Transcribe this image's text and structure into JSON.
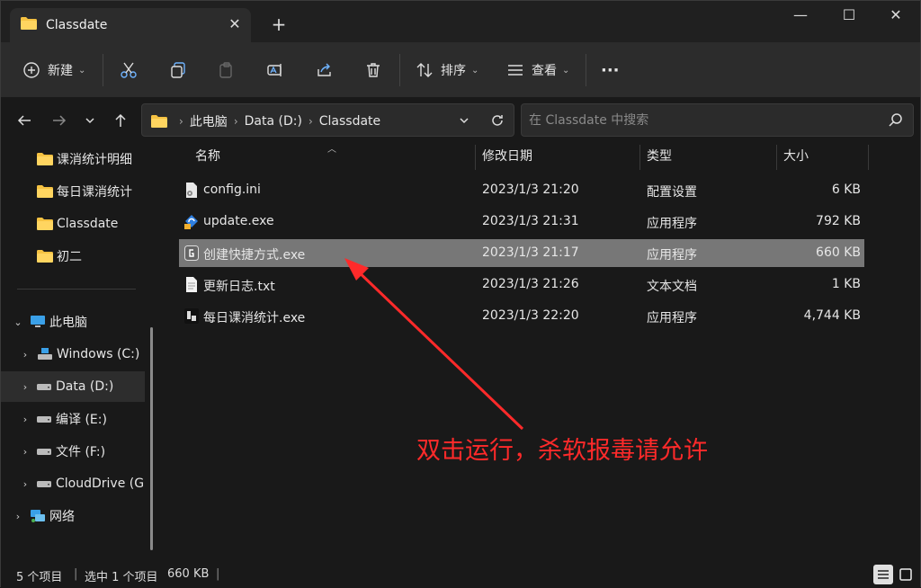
{
  "window": {
    "tab_title": "Classdate",
    "tab_close": "✕",
    "new_tab": "+",
    "minimize": "—",
    "maximize": "☐",
    "close": "✕"
  },
  "toolbar": {
    "new_label": "新建",
    "sort_label": "排序",
    "view_label": "查看",
    "more_label": "···"
  },
  "address": {
    "crumbs": [
      "此电脑",
      "Data (D:)",
      "Classdate"
    ],
    "search_placeholder": "在 Classdate 中搜索"
  },
  "sidebar": {
    "quick": [
      "课消统计明细",
      "每日课消统计",
      "Classdate",
      "初二"
    ],
    "this_pc": "此电脑",
    "drives": [
      "Windows (C:)",
      "Data (D:)",
      "编译 (E:)",
      "文件 (F:)",
      "CloudDrive (G"
    ],
    "network": "网络"
  },
  "columns": {
    "name": "名称",
    "date": "修改日期",
    "type": "类型",
    "size": "大小"
  },
  "files": [
    {
      "name": "config.ini",
      "date": "2023/1/3 21:20",
      "type": "配置设置",
      "size": "6 KB",
      "icon": "ini-file-icon"
    },
    {
      "name": "update.exe",
      "date": "2023/1/3 21:31",
      "type": "应用程序",
      "size": "792 KB",
      "icon": "update-exe-icon"
    },
    {
      "name": "创建快捷方式.exe",
      "date": "2023/1/3 21:17",
      "type": "应用程序",
      "size": "660 KB",
      "icon": "shortcut-exe-icon"
    },
    {
      "name": "更新日志.txt",
      "date": "2023/1/3 21:26",
      "type": "文本文档",
      "size": "1 KB",
      "icon": "txt-file-icon"
    },
    {
      "name": "每日课消统计.exe",
      "date": "2023/1/3 22:20",
      "type": "应用程序",
      "size": "4,744 KB",
      "icon": "app-exe-icon"
    }
  ],
  "status": {
    "count": "5 个项目",
    "selected": "选中 1 个项目",
    "selected_size": "660 KB"
  },
  "annotation": {
    "text": "双击运行，杀软报毒请允许",
    "color": "#ff2a2a"
  },
  "colors": {
    "folder": "#f5c242",
    "selected_row": "#777777",
    "background": "#191919"
  }
}
